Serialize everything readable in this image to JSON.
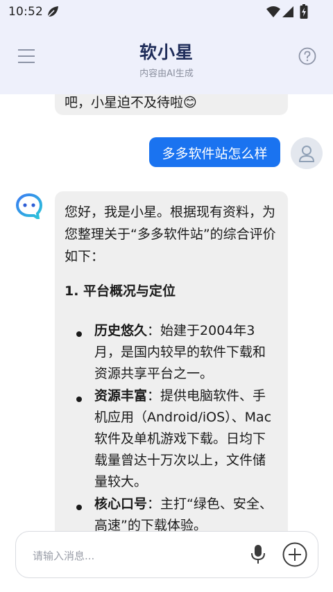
{
  "status_bar": {
    "time": "10:52",
    "icons": [
      "leaf-icon",
      "wifi-icon",
      "signal-icon",
      "battery-icon"
    ]
  },
  "header": {
    "title": "软小星",
    "subtitle": "内容由AI生成",
    "left_icon": "menu-icon",
    "right_icon": "help-icon"
  },
  "chat": {
    "previous_bot_tail": "吧，小星迫不及待啦",
    "previous_bot_emoji": "😊",
    "user_message": "多多软件站怎么样",
    "bot_intro": "您好，我是小星。根据现有资料，为您整理关于“多多软件站”的综合评价如下：",
    "bot_heading": "1. 平台概况与定位",
    "bot_items": [
      {
        "label": "历史悠久",
        "text": "：始建于2004年3月，是国内较早的软件下载和资源共享平台之一。"
      },
      {
        "label": "资源丰富",
        "text": "：提供电脑软件、手机应用（Android/iOS）、Mac软件及单机游戏下载。日均下载量曾达十万次以上，文件储量较大。"
      },
      {
        "label": "核心口号",
        "text": "：主打“绿色、安全、高速”的下载体验。"
      }
    ]
  },
  "input": {
    "placeholder": "请输入消息...",
    "mic_icon": "mic-icon",
    "add_icon": "plus-circle-icon"
  },
  "colors": {
    "header_bg": "#eef0fb",
    "title": "#1f2d5a",
    "user_bubble": "#1a73f0",
    "bot_bubble": "#efefef"
  }
}
